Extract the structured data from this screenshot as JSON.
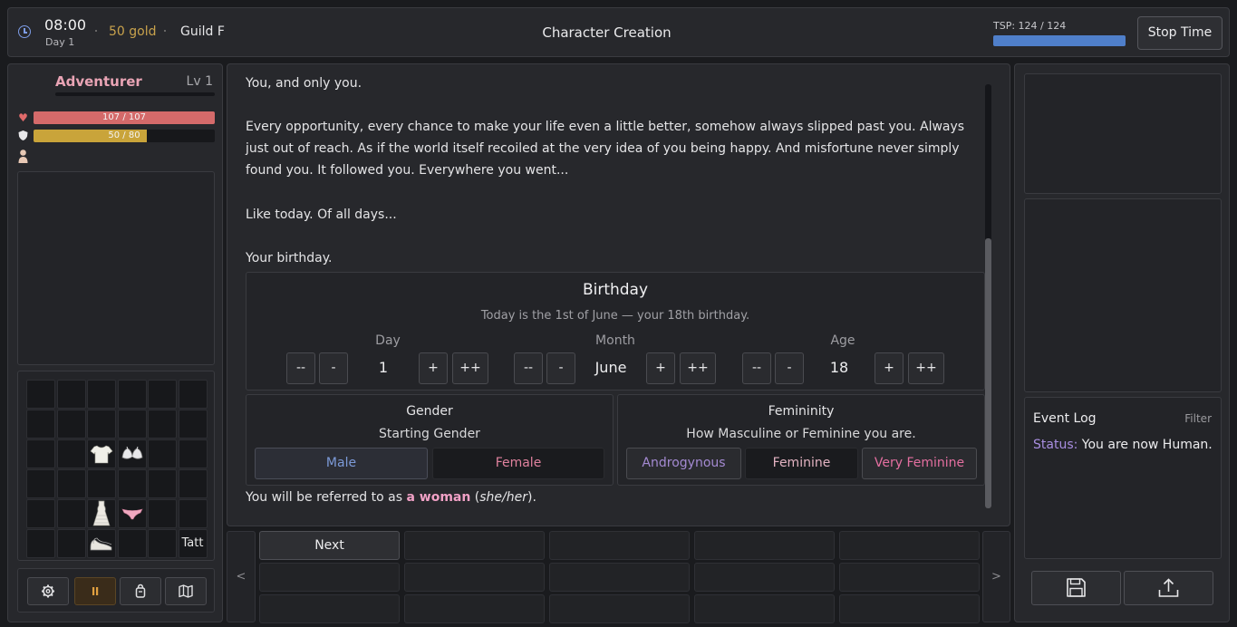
{
  "topbar": {
    "time": "08:00",
    "day": "Day 1",
    "gold": "50 gold",
    "guild": "Guild F",
    "title": "Character Creation",
    "tsp_label": "TSP: 124 / 124",
    "tsp_fraction": 1.0,
    "stop_time": "Stop Time"
  },
  "character": {
    "name": "Adventurer",
    "level": "Lv 1",
    "hp_text": "107 / 107",
    "hp_fraction": 1.0,
    "hp_color": "#d46a6a",
    "armor_text": "50 / 80",
    "armor_fraction": 0.625,
    "armor_color": "#c9a43a"
  },
  "inventory": {
    "items": [
      {
        "slot": 14,
        "name": "shirt-icon"
      },
      {
        "slot": 15,
        "name": "bra-icon"
      },
      {
        "slot": 26,
        "name": "dress-icon"
      },
      {
        "slot": 27,
        "name": "panties-icon"
      },
      {
        "slot": 32,
        "name": "shoes-icon"
      },
      {
        "slot": 35,
        "name": "tattoo-slot",
        "label": "Tatt"
      }
    ]
  },
  "story": {
    "line0": "You, and only you.",
    "para1a": "Every opportunity, every chance to make your life even a little better, somehow always slipped past you. Always",
    "para1b": "just out of reach. As if the world itself recoiled at the very idea of you being happy. And misfortune never simply",
    "para1c": "found you. It followed you. Everywhere you went...",
    "para2": "Like today. Of all days...",
    "para3": "Your birthday."
  },
  "birthday": {
    "title": "Birthday",
    "subtitle": "Today is the 1st of June — your 18th birthday.",
    "dec_big": "--",
    "dec": "-",
    "inc": "+",
    "inc_big": "++",
    "day_label": "Day",
    "day_value": "1",
    "month_label": "Month",
    "month_value": "June",
    "age_label": "Age",
    "age_value": "18"
  },
  "gender": {
    "title": "Gender",
    "subtitle": "Starting Gender",
    "male": "Male",
    "female": "Female",
    "male_color": "#7c9ad8",
    "female_color": "#e0829e"
  },
  "femininity": {
    "title": "Femininity",
    "subtitle": "How Masculine or Feminine you are.",
    "androgynous": "Androgynous",
    "feminine": "Feminine",
    "very_feminine": "Very Feminine",
    "androgynous_color": "#a48ad2",
    "feminine_color": "#e3b3c2",
    "very_feminine_color": "#e46fa0"
  },
  "pronoun": {
    "prefix": "You will be referred to as ",
    "highlight": "a woman",
    "open": " (",
    "pronouns": "she/her",
    "close": ")."
  },
  "actions": {
    "next": "Next",
    "left_arrow": "<",
    "right_arrow": ">"
  },
  "eventlog": {
    "title": "Event Log",
    "filter": "Filter",
    "status_label": "Status:",
    "status_text": " You are now Human."
  }
}
